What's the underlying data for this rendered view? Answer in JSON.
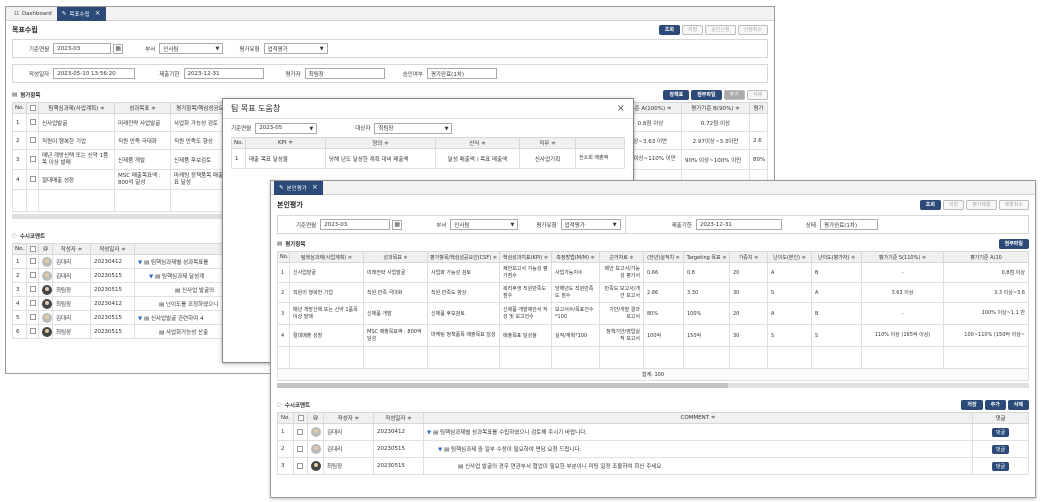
{
  "w1": {
    "tabs": [
      {
        "label": "Dashboard"
      },
      {
        "label": "목표수립"
      }
    ],
    "title": "목표수립",
    "buttons": [
      "조회",
      "저장",
      "승인신청",
      "신청취소"
    ],
    "form": {
      "base_ym_label": "기준연월",
      "base_ym": "2023-03",
      "dept_label": "부서",
      "dept": "인사팀",
      "eval_type_label": "평가유형",
      "eval_type": "업적평가",
      "created_label": "작성일자",
      "created": "2023-05-10 13:56:20",
      "deadline_label": "제출기한",
      "deadline": "2023-12-31",
      "evaluatee_label": "평가자",
      "evaluatee": "최팀장",
      "approval_label": "승인여부",
      "approval": "평가완료(1차)"
    },
    "items_label": "평가항목",
    "items_buttons": [
      "정책표",
      "첨부파일",
      "추가",
      "삭제"
    ],
    "headers": [
      "No.",
      "",
      "팀핵심과제(사업계획) ≑",
      "성과목표 ≑",
      "평가항목/핵심성공요..."
    ],
    "right_headers": [
      "기준 A(100%) ≑",
      "평가기준 B(90%) ≑",
      "평가"
    ],
    "rows": [
      {
        "no": "1",
        "task": "신사업발굴",
        "goal": "미래전략 사업발굴",
        "item": "사업화 가능성 검토",
        "a": "0.8점 이상",
        "b": "0.72점 이상",
        "c": ""
      },
      {
        "no": "2",
        "task": "직원이 행복한 기업",
        "goal": "직원 만족 극대화",
        "item": "직원 만족도 향상",
        "a": "3 이상~3.63 이만",
        "b": "2.97이상~3.3이만",
        "c": "2.6"
      },
      {
        "no": "3",
        "task": "매년 개방신택 또는 신약 1품목 이상 발매",
        "goal": "신제품 개발",
        "item": "신제품 후보검토",
        "a": "0% 이상~110% 이만",
        "b": "90% 이상~100% 이만",
        "c": "80%"
      },
      {
        "no": "4",
        "task": "절대매출 성장",
        "goal": "MSC 매출목표액 : 800억 달성",
        "item": "마케팅 정책품목 매출목표 달성",
        "a": "",
        "b": "",
        "c": ""
      }
    ],
    "comments_label": "수시코멘트",
    "comment_headers": [
      "No.",
      "",
      "@",
      "작성자 ≑",
      "작성일자 ≑"
    ],
    "comments": [
      {
        "no": "1",
        "author": "김대리",
        "date": "20230412",
        "text": "팀핵심과제별 성과목표를"
      },
      {
        "no": "2",
        "author": "김대리",
        "date": "20230515",
        "text": "팀핵심과제 달성계"
      },
      {
        "no": "3",
        "author": "최팀장",
        "date": "20230515",
        "text": "신사업 발굴의"
      },
      {
        "no": "4",
        "author": "최팀장",
        "date": "20230412",
        "text": "난이도를 조정하였으니"
      },
      {
        "no": "5",
        "author": "김대리",
        "date": "20230515",
        "text": "신사업발굴 관련하여 4"
      },
      {
        "no": "6",
        "author": "최팀장",
        "date": "20230515",
        "text": "사업화가능성 산출"
      }
    ]
  },
  "dialog": {
    "title": "팀 목표 도움창",
    "base_ym_label": "기준연월",
    "base_ym": "2023-05",
    "target_label": "대상자",
    "target": "최팀장",
    "headers": [
      "No.",
      "KPI ≑",
      "정의 ≑",
      "산식 ≑",
      "직무 ≑",
      ""
    ],
    "rows": [
      {
        "no": "1",
        "kpi": "매출 목표 달성율",
        "def": "당해 년도 달성한 계획 대비 매출액",
        "formula": "달성 매출액 / 목표 매출액",
        "job": "신사업기획",
        "extra": "한소희 매출액"
      }
    ]
  },
  "w2": {
    "tab": "본인평가",
    "title": "본인평가",
    "buttons": [
      "조회",
      "저장",
      "평가제출",
      "제출취소"
    ],
    "form": {
      "base_ym_label": "기준연월",
      "base_ym": "2023-03",
      "dept_label": "부서",
      "dept": "인사팀",
      "eval_type_label": "평가유형",
      "eval_type": "업적평가",
      "deadline_label": "제출기한",
      "deadline": "2023-12-31",
      "status_label": "상태",
      "status": "평가완료(1차)"
    },
    "items_label": "평가항목",
    "attach": "첨부파일",
    "headers": [
      "No.",
      "팀핵심과제(사업계획) ≑",
      "성과목표 ≑",
      "평가항목/핵심성공요인(CSF) ≑",
      "핵심성과지표(KPI) ≑",
      "측정방법(M/M) ≑",
      "근거자료 ≑",
      "(전년)실적치 ≑",
      "Targeting 목표 ≑",
      "가중치 ≑",
      "난이도(본인) ≑",
      "난이도(평가자) ≑",
      "평가기준 S(110%) ≑",
      "평가기준 A(10"
    ],
    "rows": [
      {
        "no": "1",
        "task": "신사업발굴",
        "goal": "미래전략 사업발굴",
        "item": "사업화 가능성 검토",
        "kpi": "제안보고서 가능성 평가점수",
        "mm": "사업가능지수",
        "evid": "제안 보고서/가능성 평가서",
        "prev": "0.66",
        "target": "0.8",
        "weight": "20",
        "d1": "A",
        "d2": "B",
        "s": "-",
        "a": "0.8점 이상"
      },
      {
        "no": "2",
        "task": "직원이 행복한 기업",
        "goal": "직원 만족 극대화",
        "item": "직원 만족도 향상",
        "kpi": "복리후생 직원만족도 점수",
        "mm": "당해년도 직원만족도 점수",
        "evid": "만족도 보고서/개선 보고서",
        "prev": "2.86",
        "target": "3.30",
        "weight": "30",
        "d1": "S",
        "d2": "A",
        "s": "3.63 이상",
        "a": "3.3 이상~3.6"
      },
      {
        "no": "3",
        "task": "매년 개방신택 또는 신약 1품목 이상 발매",
        "goal": "신제품 개발",
        "item": "신제품 후보검토",
        "kpi": "신제품 개발제안서 작성 및 보고건수",
        "mm": "보고서수/목표건수*100",
        "evid": "기안/개발 결과 보고서",
        "prev": "80%",
        "target": "100%",
        "weight": "20",
        "d1": "A",
        "d2": "B",
        "s": "-",
        "a": "100% 이상~1.1 만"
      },
      {
        "no": "4",
        "task": "절대매출 성장",
        "goal": "MSC 매출목표액 : 800억 달성",
        "item": "마케팅 정책품목 매출목표 달성",
        "kpi": "매출목표 달성율",
        "mm": "실적/계획*100",
        "evid": "정책기안/영업실적 보고서",
        "prev": "100억",
        "target": "150억",
        "weight": "30",
        "d1": "S",
        "d2": "S",
        "s": "110% 이상 (165억 이상)",
        "a": "100~110% (150억 이상~"
      }
    ],
    "total": "합계: 100",
    "comments_label": "수시코멘트",
    "comment_buttons": [
      "저장",
      "추가",
      "삭제"
    ],
    "comment_headers": [
      "No.",
      "",
      "@",
      "작성자 ≑",
      "작성일자 ≑",
      "COMMENT ≑",
      "댓글"
    ],
    "comments": [
      {
        "no": "1",
        "author": "김대리",
        "date": "20230412",
        "text": "팀핵심과제별 성과목표를 수립하였으니 검토해 주시기 바랍니다.",
        "reply": "댓글"
      },
      {
        "no": "2",
        "author": "김대리",
        "date": "20230515",
        "text": "팀핵심과제 중 일부 수정이 필요하여 면담 요청 드립니다.",
        "reply": "댓글"
      },
      {
        "no": "3",
        "author": "최팀장",
        "date": "20230515",
        "text": "신사업 발굴의 경우 연관부서 협업이 필요한 부분이니 미팅 일정 조율하여 회신 주세요",
        "reply": "댓글"
      }
    ]
  }
}
